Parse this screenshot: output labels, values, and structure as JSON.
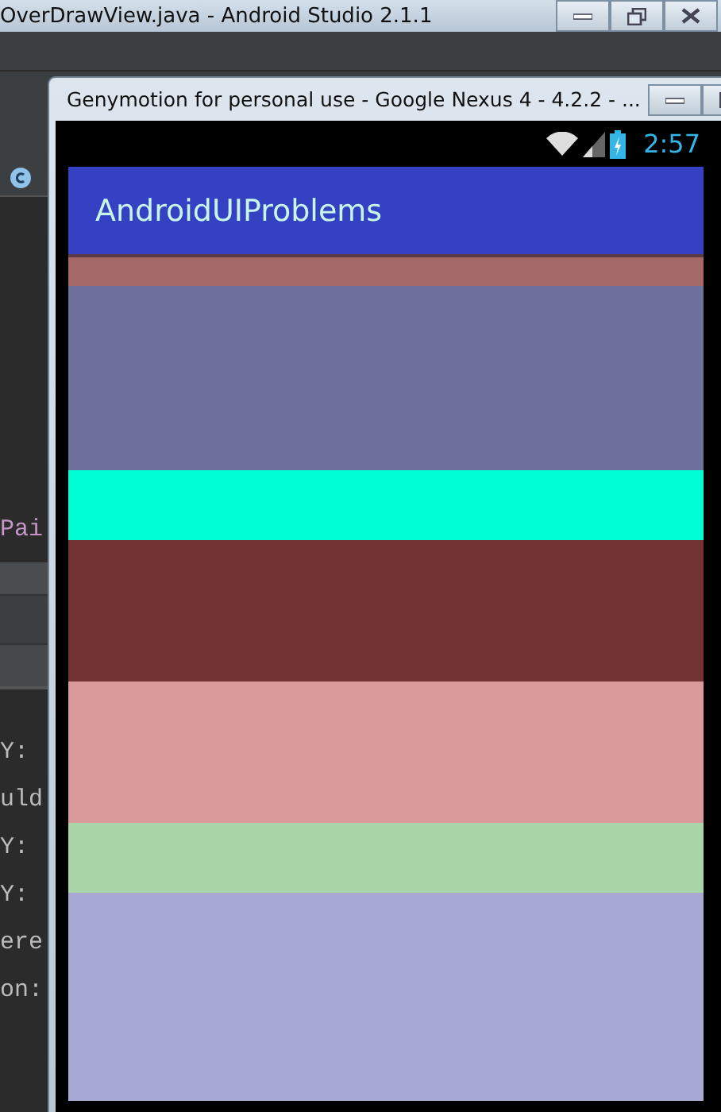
{
  "ide_window": {
    "title": "OverDrawView.java - Android Studio 2.1.1"
  },
  "editor_fragments": [
    {
      "text": "Pai"
    }
  ],
  "console_fragments": [
    {
      "text": "Y:"
    },
    {
      "text": "uld"
    },
    {
      "text": "Y:"
    },
    {
      "text": "Y:"
    },
    {
      "text": "ere"
    },
    {
      "text": "on:"
    }
  ],
  "emulator_window": {
    "title": "Genymotion for personal use - Google Nexus 4 - 4.2.2 - ..."
  },
  "status_bar": {
    "time": "2:57"
  },
  "app_bar": {
    "title": "AndroidUIProblems"
  },
  "bands": [
    {
      "color": "#a46866"
    },
    {
      "color": "#6e709c"
    },
    {
      "color": "#00ffd4"
    },
    {
      "color": "#733333"
    },
    {
      "color": "#d89a9a"
    },
    {
      "color": "#a8d4a8"
    },
    {
      "color": "#a8a8d4"
    }
  ]
}
